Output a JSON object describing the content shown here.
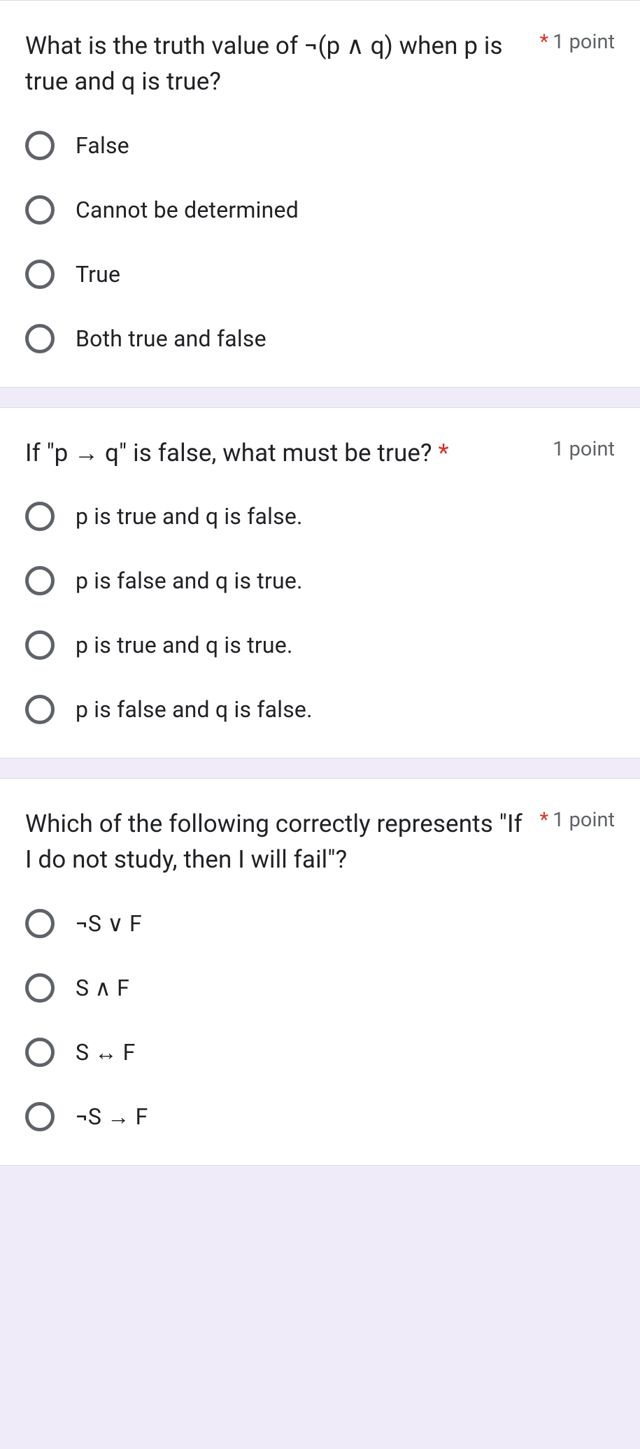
{
  "questions": [
    {
      "text": "What is the truth value of ¬(p ∧ q) when p is true and q is true?",
      "required": true,
      "points": "1 point",
      "options": [
        "False",
        "Cannot be determined",
        "True",
        "Both true and false"
      ]
    },
    {
      "text": "If \"p  →  q\" is false, what must be true?",
      "required": true,
      "points": "1 point",
      "options": [
        "p is true and q is false.",
        "p is false and q is true.",
        "p is true and q is true.",
        "p is false and q is false."
      ]
    },
    {
      "text": "Which of the following correctly represents \"If I do not study, then I will fail\"?",
      "required": true,
      "points": "1 point",
      "options": [
        "¬S ∨ F",
        "S ∧ F",
        "S  ↔  F",
        "¬S  →  F"
      ]
    }
  ]
}
